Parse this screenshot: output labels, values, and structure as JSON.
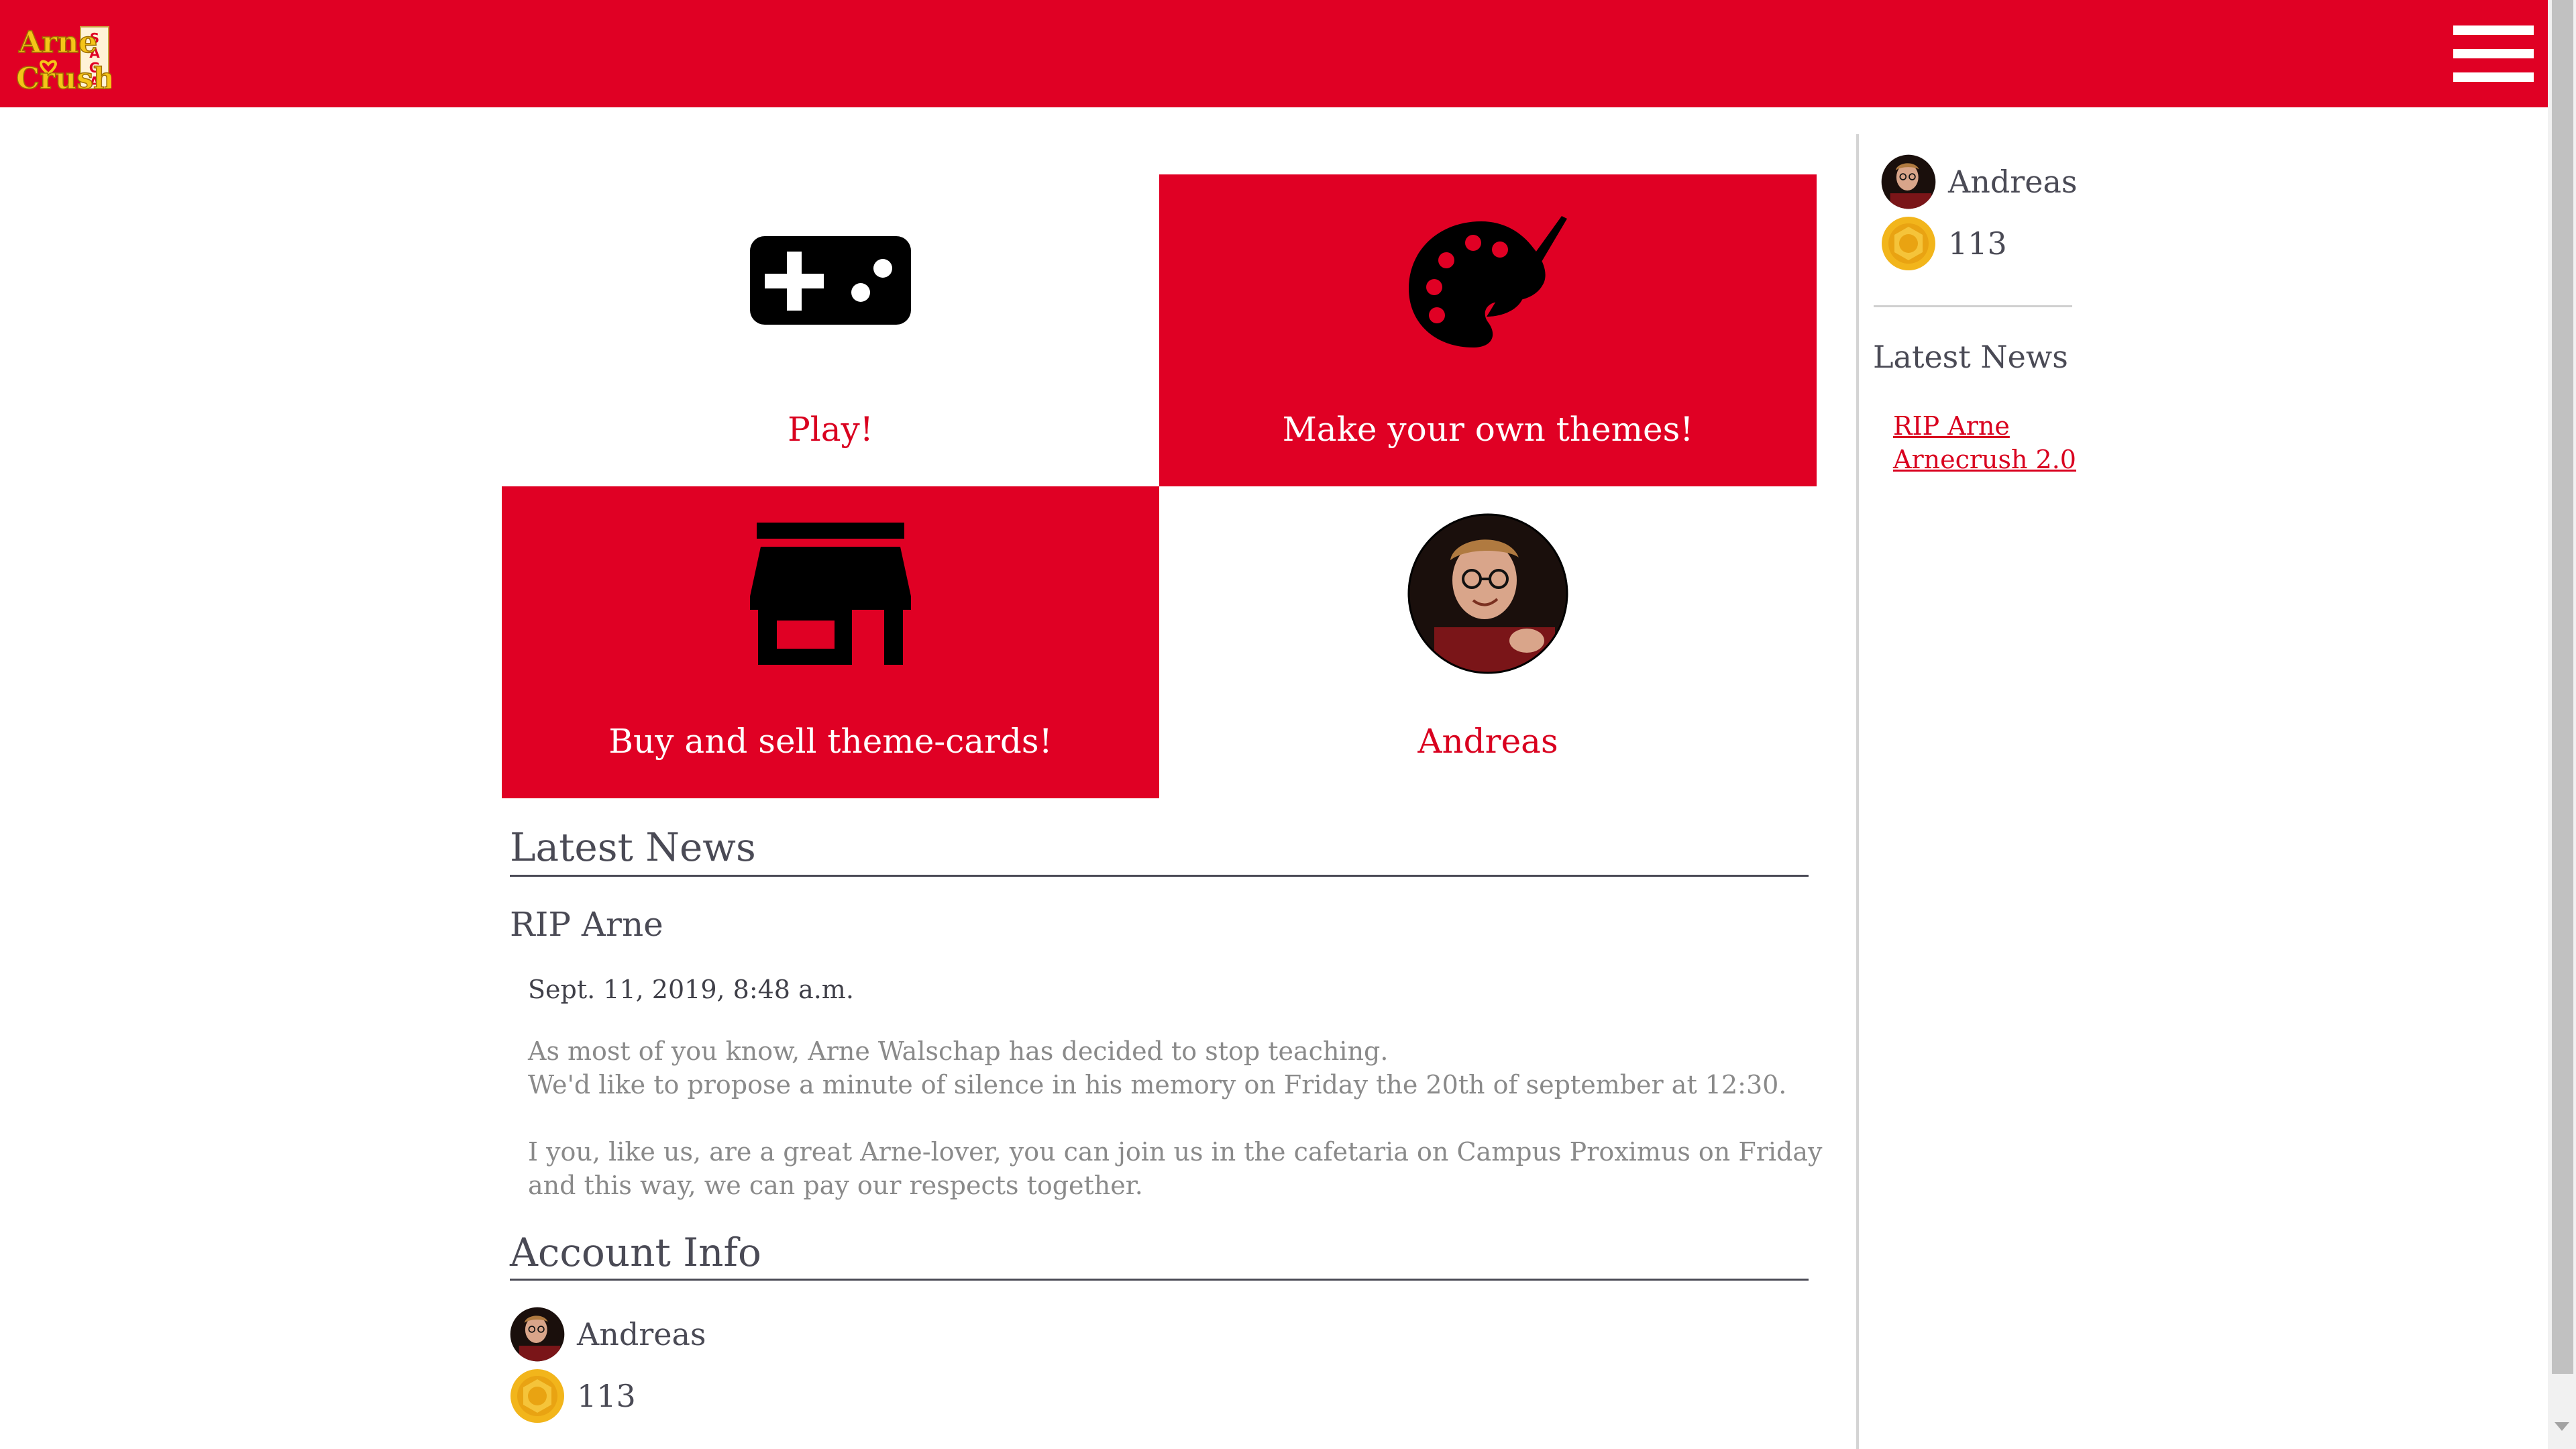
{
  "app": {
    "logo_text": "Arne Crush SAGA",
    "colors": {
      "brand": "#e00024",
      "text": "#4a4a55",
      "muted": "#8a8a8a",
      "coin": "#f2b51b"
    }
  },
  "navbar": {
    "menu_icon": "hamburger-menu-icon"
  },
  "tiles": [
    {
      "label": "Play!",
      "icon": "gamepad-icon"
    },
    {
      "label": "Make your own themes!",
      "icon": "palette-icon"
    },
    {
      "label": "Buy and sell theme-cards!",
      "icon": "store-icon"
    },
    {
      "label": "Andreas",
      "icon": "profile-avatar"
    }
  ],
  "news": {
    "heading": "Latest News",
    "items": [
      {
        "title": "RIP Arne",
        "date": "Sept. 11, 2019, 8:48 a.m.",
        "paragraph1_line1": "As most of you know, Arne Walschap has decided to stop teaching.",
        "paragraph1_line2": "We'd like to propose a minute of silence in his memory on Friday the 20th of september at 12:30.",
        "paragraph2": "I you, like us, are a great Arne-lover, you can join us in the cafetaria on Campus Proximus on Friday and this way, we can pay our respects together."
      }
    ]
  },
  "account": {
    "heading": "Account Info",
    "username": "Andreas",
    "coins": "113"
  },
  "sidebar": {
    "username": "Andreas",
    "coins": "113",
    "news_heading": "Latest News",
    "links": [
      "RIP Arne",
      "Arnecrush 2.0"
    ]
  }
}
